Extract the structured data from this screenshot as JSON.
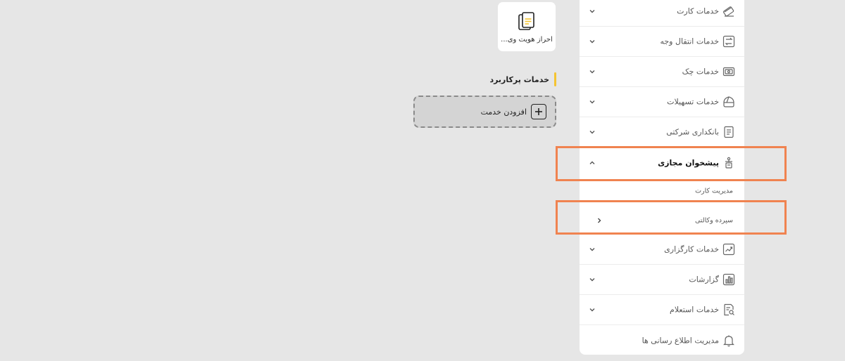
{
  "service_card": {
    "label": "احراز هویت وی..."
  },
  "frequent_section": {
    "title": "خدمات پرکاربرد"
  },
  "add_service": {
    "label": "افزودن خدمت"
  },
  "sidebar": {
    "items": [
      {
        "label": "خدمات کارت",
        "icon": "card-icon"
      },
      {
        "label": "خدمات انتقال وجه",
        "icon": "transfer-icon"
      },
      {
        "label": "خدمات چک",
        "icon": "cheque-icon"
      },
      {
        "label": "خدمات تسهیلات",
        "icon": "loan-icon"
      },
      {
        "label": "بانکداری شرکتی",
        "icon": "corporate-doc-icon"
      },
      {
        "label": "پیشخوان مجازی",
        "icon": "virtual-counter-icon"
      },
      {
        "label": "خدمات کارگزاری",
        "icon": "brokerage-icon"
      },
      {
        "label": "گزارشات",
        "icon": "reports-icon"
      },
      {
        "label": "خدمات استعلام",
        "icon": "inquiry-icon"
      },
      {
        "label": "مدیریت اطلاع رسانی ها",
        "icon": "bell-icon"
      }
    ],
    "sub_items": [
      {
        "label": "مدیریت کارت"
      },
      {
        "label": "سپرده وکالتی"
      }
    ]
  },
  "colors": {
    "background": "#e6e6e6",
    "accent_yellow": "#f5c431",
    "highlight_orange": "#f08350"
  }
}
